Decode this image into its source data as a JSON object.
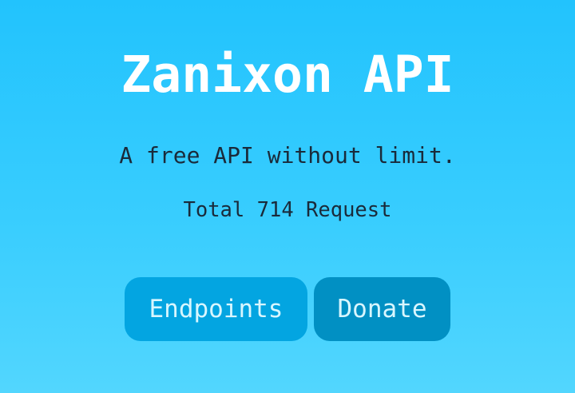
{
  "header": {
    "title": "Zanixon API",
    "subtitle": "A free API without limit."
  },
  "stats": {
    "total_text": "Total 714 Request"
  },
  "buttons": {
    "endpoints": "Endpoints",
    "donate": "Donate"
  },
  "colors": {
    "endpoints_bg": "#03a5e1",
    "donate_bg": "#0190c3",
    "bg_top": "#22c3fd",
    "bg_bottom": "#52d6fe"
  }
}
